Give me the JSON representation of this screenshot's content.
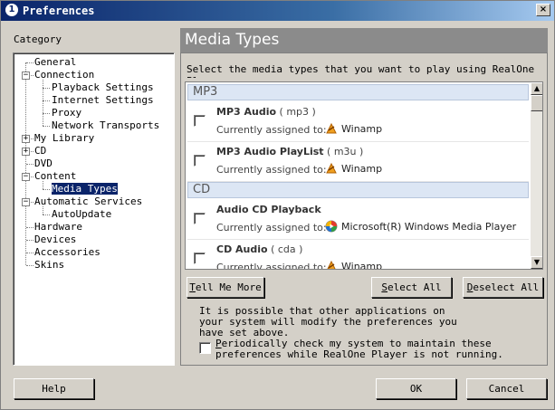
{
  "window": {
    "title": "Preferences",
    "close_glyph": "×"
  },
  "category_label": "Category",
  "tree": [
    {
      "label": "General",
      "expander": null,
      "selected": false
    },
    {
      "label": "Connection",
      "expander": "−",
      "selected": false
    },
    {
      "label": "Playback Settings",
      "expander": null,
      "selected": false
    },
    {
      "label": "Internet Settings",
      "expander": null,
      "selected": false
    },
    {
      "label": "Proxy",
      "expander": null,
      "selected": false
    },
    {
      "label": "Network Transports",
      "expander": null,
      "selected": false
    },
    {
      "label": "My Library",
      "expander": "+",
      "selected": false
    },
    {
      "label": "CD",
      "expander": "+",
      "selected": false
    },
    {
      "label": "DVD",
      "expander": null,
      "selected": false
    },
    {
      "label": "Content",
      "expander": "−",
      "selected": false
    },
    {
      "label": "Media Types",
      "expander": null,
      "selected": true
    },
    {
      "label": "Automatic Services",
      "expander": "−",
      "selected": false
    },
    {
      "label": "AutoUpdate",
      "expander": null,
      "selected": false
    },
    {
      "label": "Hardware",
      "expander": null,
      "selected": false
    },
    {
      "label": "Devices",
      "expander": null,
      "selected": false
    },
    {
      "label": "Accessories",
      "expander": null,
      "selected": false
    },
    {
      "label": "Skins",
      "expander": null,
      "selected": false
    }
  ],
  "panel": {
    "title": "Media Types",
    "instructions": "Select the media types that you want to play using RealOne Pl",
    "assigned_label": "Currently assigned to:",
    "groups": [
      {
        "name": "MP3",
        "entries": [
          {
            "name": "MP3 Audio",
            "ext": "( mp3 )",
            "player": "Winamp",
            "player_icon": "winamp-icon"
          },
          {
            "name": "MP3 Audio PlayList",
            "ext": "( m3u )",
            "player": "Winamp",
            "player_icon": "winamp-icon"
          }
        ]
      },
      {
        "name": "CD",
        "entries": [
          {
            "name": "Audio CD Playback",
            "ext": "",
            "player": "Microsoft(R) Windows Media Player",
            "player_icon": "windows-media-player-icon"
          },
          {
            "name": "CD Audio",
            "ext": "( cda )",
            "player": "Winamp",
            "player_icon": "winamp-icon"
          }
        ]
      }
    ],
    "scroll_up_glyph": "▲",
    "scroll_down_glyph": "▼"
  },
  "buttons": {
    "tell_me_more": "Tell Me More",
    "select_all": "Select All",
    "deselect_all": "Deselect All",
    "help": "Help",
    "ok": "OK",
    "cancel": "Cancel"
  },
  "note": "It is possible that other applications on your system will modify the preferences you have set above.",
  "periodic_check": {
    "label": "Periodically check my system to maintain these preferences while RealOne Player is not running.",
    "checked": false
  },
  "colors": {
    "title_bar": "#0a246a",
    "panel_header": "#8b8b8b",
    "group_header": "#dce6f4",
    "selected_item": "#0a246a",
    "winamp_icon": "#f0a020"
  }
}
